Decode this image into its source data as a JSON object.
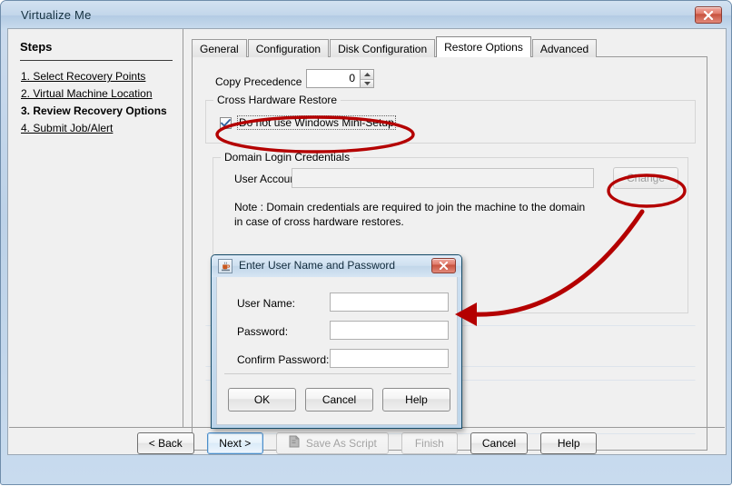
{
  "window": {
    "title": "Virtualize Me",
    "close_icon": "close-icon"
  },
  "sidebar": {
    "heading": "Steps",
    "items": [
      {
        "label": "1. Select Recovery Points",
        "current": false
      },
      {
        "label": "2. Virtual Machine Location",
        "current": false
      },
      {
        "label": "3. Review Recovery Options",
        "current": true
      },
      {
        "label": "4. Submit Job/Alert",
        "current": false
      }
    ]
  },
  "tabs": [
    {
      "label": "General",
      "active": false
    },
    {
      "label": "Configuration",
      "active": false
    },
    {
      "label": "Disk Configuration",
      "active": false
    },
    {
      "label": "Restore Options",
      "active": true
    },
    {
      "label": "Advanced",
      "active": false
    }
  ],
  "restore_options": {
    "copy_precedence_label": "Copy Precedence",
    "copy_precedence_value": "0",
    "spinner_up_icon": "spinner-up-icon",
    "spinner_down_icon": "spinner-down-icon",
    "cross_hardware_group": "Cross Hardware Restore",
    "mini_setup_label": "Do not use Windows Mini-Setup",
    "mini_setup_checked": true,
    "check_icon": "check-icon",
    "domain_group": "Domain Login Credentials",
    "user_account_label": "User Account",
    "user_account_value": "",
    "user_account_placeholder": "",
    "change_label": "Change",
    "note_line1": "Note : Domain credentials are required to join the machine to the domain",
    "note_line2": "in case of cross hardware restores."
  },
  "buttonbar": {
    "back": "< Back",
    "next": "Next >",
    "save_as_script": "Save As Script",
    "save_as_script_icon": "script-icon",
    "finish": "Finish",
    "cancel": "Cancel",
    "help": "Help"
  },
  "dialog": {
    "title": "Enter User Name and Password",
    "app_icon": "java-coffee-cup-icon",
    "close_icon": "close-icon",
    "fields": [
      {
        "label": "User Name:",
        "value": ""
      },
      {
        "label": "Password:",
        "value": ""
      },
      {
        "label": "Confirm Password:",
        "value": ""
      }
    ],
    "buttons": [
      {
        "label": "OK"
      },
      {
        "label": "Cancel"
      },
      {
        "label": "Help"
      }
    ]
  },
  "annotations": {
    "color": "#b40000",
    "ellipse_checkbox": "highlight around 'Do not use Windows Mini-Setup' checkbox",
    "ellipse_change": "highlight around 'Change' button",
    "arrow": "curved arrow from Change button to the Enter User Name and Password dialog"
  }
}
